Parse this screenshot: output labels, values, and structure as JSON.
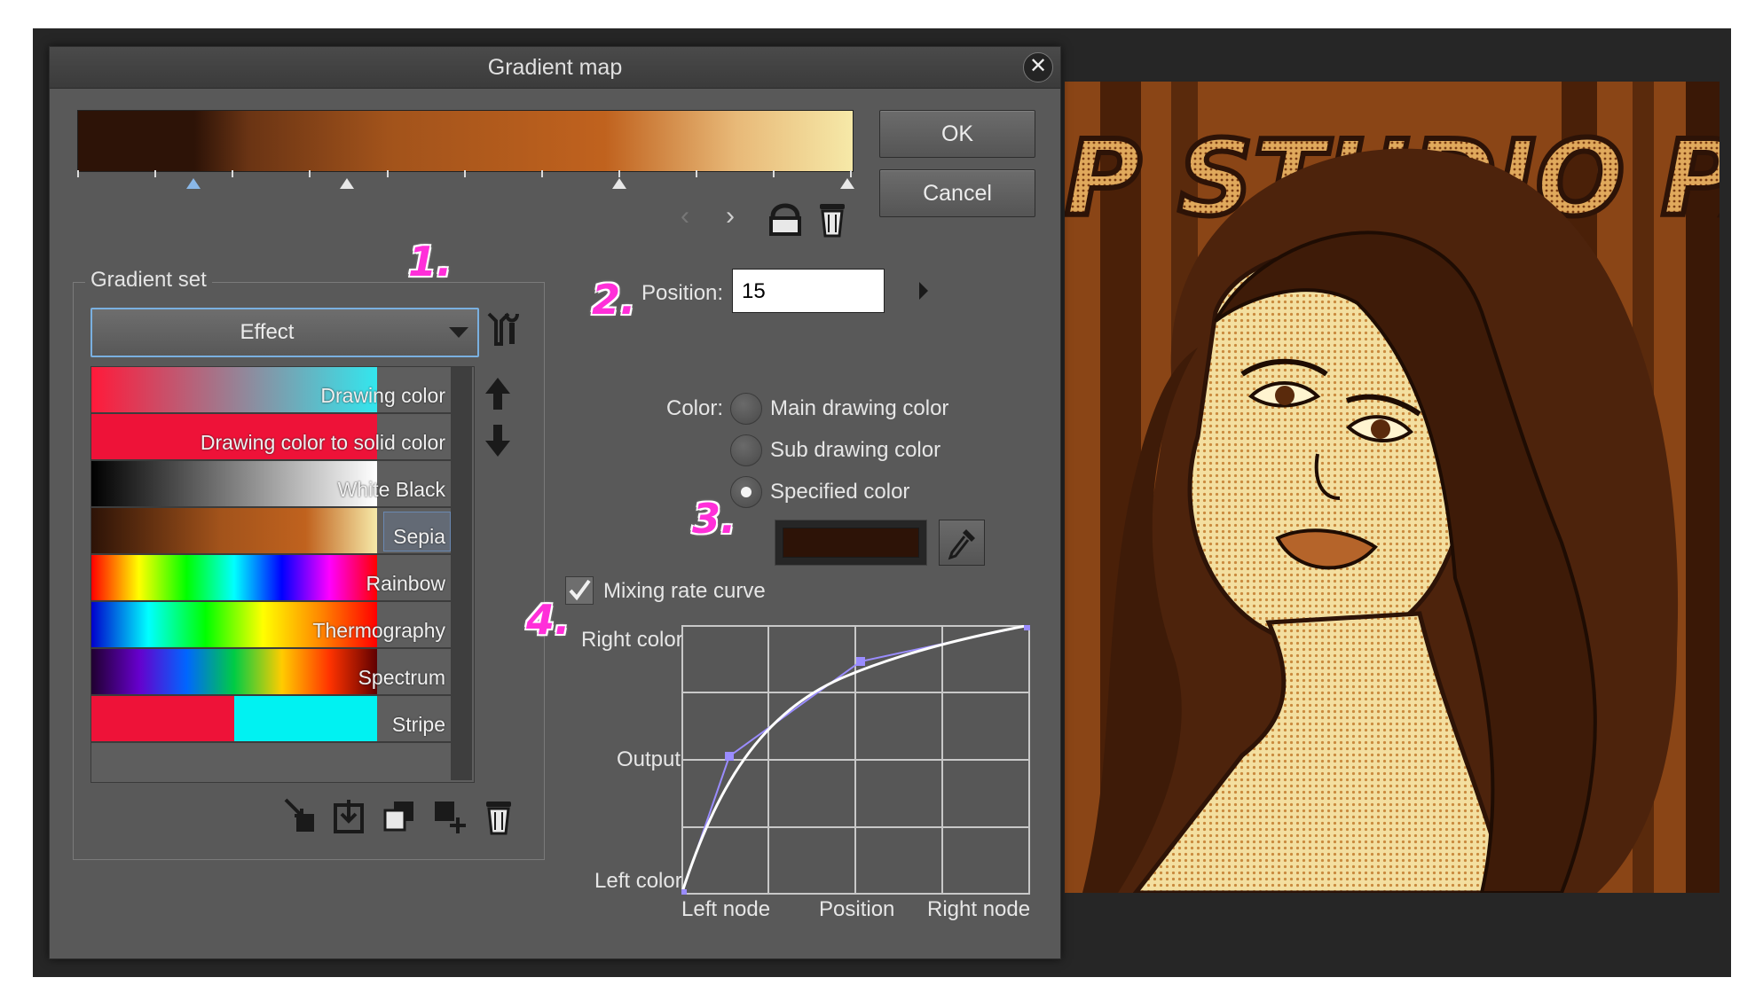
{
  "dialog": {
    "title": "Gradient map",
    "close_glyph": "✕",
    "ok_label": "OK",
    "cancel_label": "Cancel",
    "prev_glyph": "‹",
    "next_glyph": "›"
  },
  "gradient_set": {
    "label": "Gradient set",
    "selected_set": "Effect",
    "items": [
      {
        "label": "Drawing color",
        "selected": false
      },
      {
        "label": "Drawing color to solid color",
        "selected": false
      },
      {
        "label": "White Black",
        "selected": false
      },
      {
        "label": "Sepia",
        "selected": true
      },
      {
        "label": "Rainbow",
        "selected": false
      },
      {
        "label": "Thermography",
        "selected": false
      },
      {
        "label": "Spectrum",
        "selected": false
      },
      {
        "label": "Stripe",
        "selected": false
      }
    ]
  },
  "node_settings": {
    "position_label": "Position:",
    "position_value": "15",
    "color_label": "Color:",
    "color_options": [
      "Main drawing color",
      "Sub drawing color",
      "Specified color"
    ],
    "selected_color_option": "Specified color",
    "specified_color": "#2d1307"
  },
  "curve": {
    "enabled": true,
    "checkbox_label": "Mixing rate curve",
    "right_color_label": "Right color",
    "output_label": "Output",
    "left_color_label": "Left color",
    "left_node_label": "Left node",
    "position_label": "Position",
    "right_node_label": "Right node"
  },
  "annotations": [
    "1.",
    "2.",
    "3.",
    "4."
  ],
  "canvas": {
    "title_text": "P STUDIO PAINT"
  },
  "colors": {
    "dialog_bg": "#595959",
    "sepia_dark": "#2d1307",
    "sepia_mid": "#c0621e",
    "sepia_light": "#f6e9a8",
    "annotation": "#ff2fd9"
  }
}
